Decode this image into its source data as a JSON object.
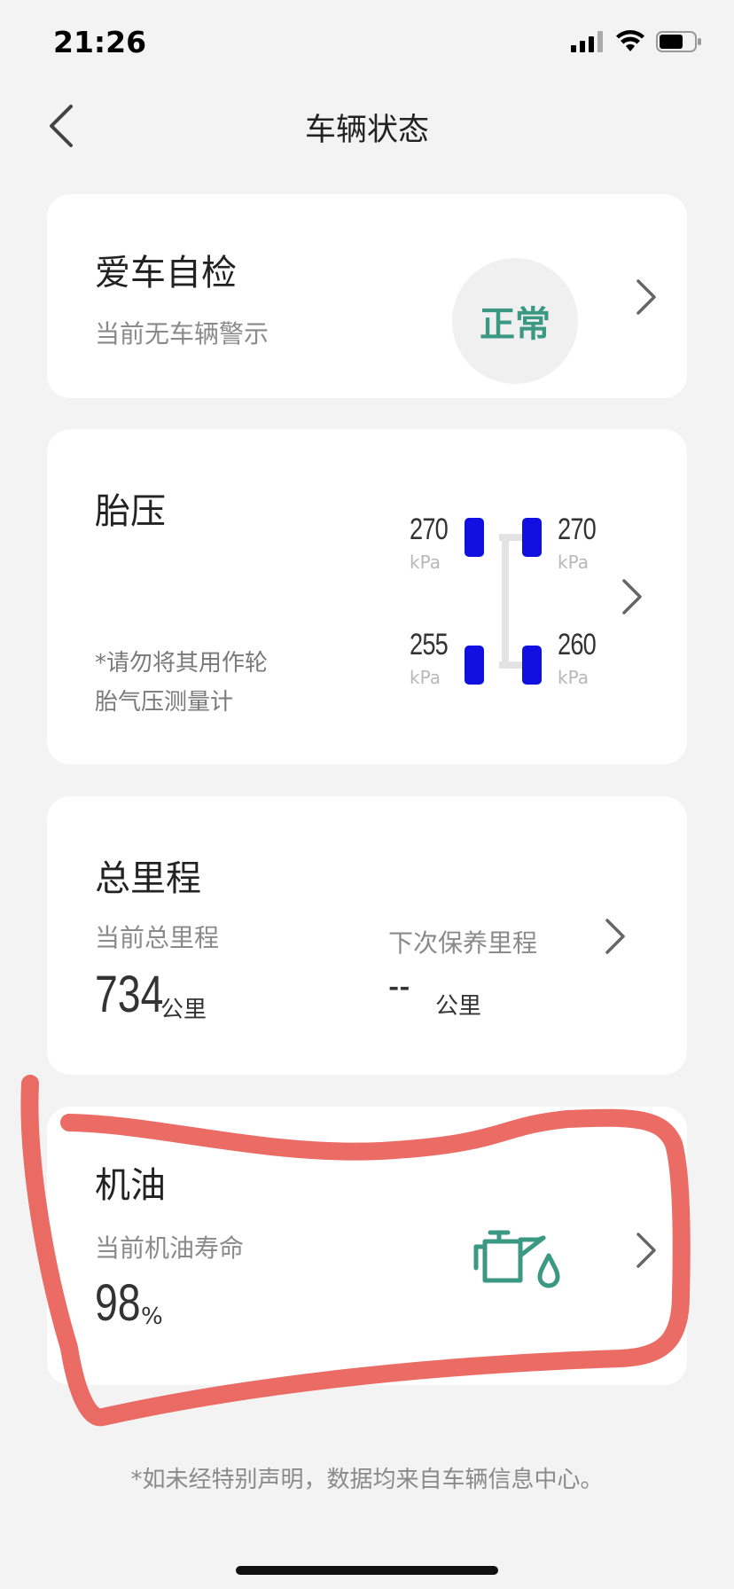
{
  "status_bar": {
    "time": "21:26",
    "signal_icon": "signal-bars-icon",
    "wifi_icon": "wifi-icon",
    "battery_icon": "battery-icon"
  },
  "nav": {
    "title": "车辆状态",
    "back_icon": "back-chevron-icon"
  },
  "self_check": {
    "title": "爱车自检",
    "subtitle": "当前无车辆警示",
    "status": "正常",
    "status_color": "#3a9883"
  },
  "tire_pressure": {
    "title": "胎压",
    "note_line1": "*请勿将其用作轮",
    "note_line2": "胎气压测量计",
    "unit": "kPa",
    "front_left": "270",
    "front_right": "270",
    "rear_left": "255",
    "rear_right": "260",
    "tire_color": "#1010e0"
  },
  "mileage": {
    "title": "总里程",
    "current_label": "当前总里程",
    "current_value": "734",
    "current_unit": "公里",
    "next_service_label": "下次保养里程",
    "next_service_value": "--",
    "next_service_unit": "公里"
  },
  "oil": {
    "title": "机油",
    "label": "当前机油寿命",
    "value": "98",
    "unit": "%",
    "icon": "oil-can-icon",
    "icon_color": "#3a9883"
  },
  "footer": {
    "note": "*如未经特别声明，数据均来自车辆信息中心。"
  },
  "annotation_color": "#e8524a"
}
